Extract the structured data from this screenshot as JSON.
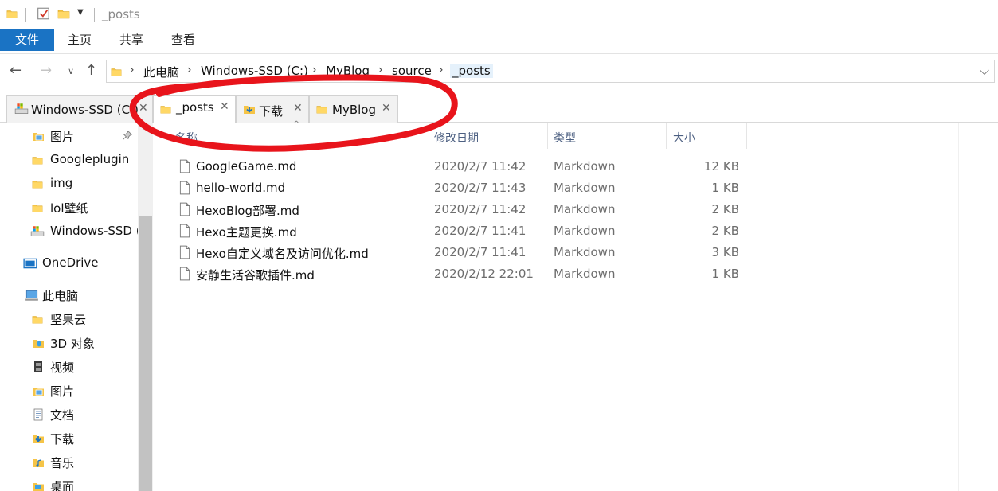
{
  "window": {
    "title": "_posts"
  },
  "ribbon": {
    "tabs": [
      "文件",
      "主页",
      "共享",
      "查看"
    ]
  },
  "address_bar": {
    "segments": [
      "此电脑",
      "Windows-SSD (C:)",
      "MyBlog",
      "source",
      "_posts"
    ]
  },
  "folder_tabs": [
    {
      "label": "Windows-SSD (C:)",
      "icon": "drive-icon"
    },
    {
      "label": "_posts",
      "icon": "folder-icon",
      "active": true
    },
    {
      "label": "下载",
      "icon": "download-folder-icon"
    },
    {
      "label": "MyBlog",
      "icon": "folder-icon"
    }
  ],
  "sidebar": {
    "items": [
      {
        "label": "图片",
        "icon": "pictures-folder-icon",
        "pinned": true
      },
      {
        "label": "Googleplugin",
        "icon": "folder-icon"
      },
      {
        "label": "img",
        "icon": "folder-icon"
      },
      {
        "label": "lol壁纸",
        "icon": "folder-icon"
      },
      {
        "label": "Windows-SSD (",
        "icon": "drive-icon"
      },
      {
        "label": "OneDrive",
        "icon": "onedrive-icon"
      },
      {
        "label": "此电脑",
        "icon": "this-pc-icon"
      },
      {
        "label": "坚果云",
        "icon": "folder-icon"
      },
      {
        "label": "3D 对象",
        "icon": "3d-objects-icon"
      },
      {
        "label": "视频",
        "icon": "videos-icon"
      },
      {
        "label": "图片",
        "icon": "pictures-folder-icon"
      },
      {
        "label": "文档",
        "icon": "documents-icon"
      },
      {
        "label": "下载",
        "icon": "download-folder-icon"
      },
      {
        "label": "音乐",
        "icon": "music-icon"
      },
      {
        "label": "桌面",
        "icon": "desktop-folder-icon"
      }
    ]
  },
  "columns": {
    "name": "名称",
    "date": "修改日期",
    "type": "类型",
    "size": "大小"
  },
  "files": [
    {
      "name": "GoogleGame.md",
      "date": "2020/2/7 11:42",
      "type": "Markdown",
      "size": "12 KB"
    },
    {
      "name": "hello-world.md",
      "date": "2020/2/7 11:43",
      "type": "Markdown",
      "size": "1 KB"
    },
    {
      "name": "HexoBlog部署.md",
      "date": "2020/2/7 11:42",
      "type": "Markdown",
      "size": "2 KB"
    },
    {
      "name": "Hexo主题更换.md",
      "date": "2020/2/7 11:41",
      "type": "Markdown",
      "size": "2 KB"
    },
    {
      "name": "Hexo自定义域名及访问优化.md",
      "date": "2020/2/7 11:41",
      "type": "Markdown",
      "size": "3 KB"
    },
    {
      "name": "安静生活谷歌插件.md",
      "date": "2020/2/12 22:01",
      "type": "Markdown",
      "size": "1 KB"
    }
  ],
  "colors": {
    "accent": "#1a73c4",
    "folder": "#f5c447",
    "annotation": "#e8141b"
  }
}
